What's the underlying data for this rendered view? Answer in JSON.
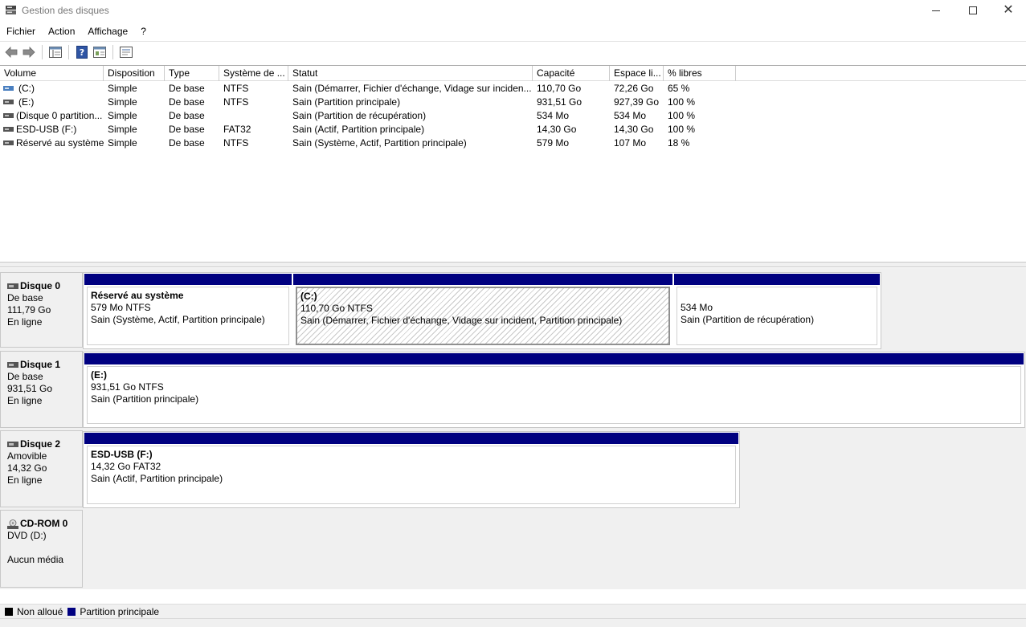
{
  "window": {
    "title": "Gestion des disques"
  },
  "menu": [
    "Fichier",
    "Action",
    "Affichage",
    "?"
  ],
  "volume_table": {
    "columns": [
      "Volume",
      "Disposition",
      "Type",
      "Système de ...",
      "Statut",
      "Capacité",
      "Espace li...",
      "% libres"
    ],
    "rows": [
      {
        "volume": "(C:)",
        "disposition": "Simple",
        "type": "De base",
        "fs": "NTFS",
        "status": "Sain (Démarrer, Fichier d'échange, Vidage sur inciden...",
        "capacity": "110,70 Go",
        "free": "72,26 Go",
        "pct": "65 %"
      },
      {
        "volume": "(E:)",
        "disposition": "Simple",
        "type": "De base",
        "fs": "NTFS",
        "status": "Sain (Partition principale)",
        "capacity": "931,51 Go",
        "free": "927,39 Go",
        "pct": "100 %"
      },
      {
        "volume": "(Disque 0 partition...",
        "disposition": "Simple",
        "type": "De base",
        "fs": "",
        "status": "Sain (Partition de récupération)",
        "capacity": "534 Mo",
        "free": "534 Mo",
        "pct": "100 %"
      },
      {
        "volume": "ESD-USB (F:)",
        "disposition": "Simple",
        "type": "De base",
        "fs": "FAT32",
        "status": "Sain (Actif, Partition principale)",
        "capacity": "14,30 Go",
        "free": "14,30 Go",
        "pct": "100 %"
      },
      {
        "volume": "Réservé au système",
        "disposition": "Simple",
        "type": "De base",
        "fs": "NTFS",
        "status": "Sain (Système, Actif, Partition principale)",
        "capacity": "579 Mo",
        "free": "107 Mo",
        "pct": "18 %"
      }
    ]
  },
  "disks": [
    {
      "name": "Disque 0",
      "kind": "De base",
      "size": "111,79 Go",
      "state": "En ligne",
      "partitions": [
        {
          "name": "Réservé au système",
          "size": "579 Mo NTFS",
          "status": "Sain (Système, Actif, Partition principale)"
        },
        {
          "name": "(C:)",
          "size": "110,70 Go NTFS",
          "status": "Sain (Démarrer, Fichier d'échange, Vidage sur incident, Partition principale)"
        },
        {
          "name": "",
          "size": "534 Mo",
          "status": "Sain (Partition de récupération)"
        }
      ]
    },
    {
      "name": "Disque 1",
      "kind": "De base",
      "size": "931,51 Go",
      "state": "En ligne",
      "partitions": [
        {
          "name": "(E:)",
          "size": "931,51 Go NTFS",
          "status": "Sain (Partition principale)"
        }
      ]
    },
    {
      "name": "Disque 2",
      "kind": "Amovible",
      "size": "14,32 Go",
      "state": "En ligne",
      "partitions": [
        {
          "name": "ESD-USB  (F:)",
          "size": "14,32 Go FAT32",
          "status": "Sain (Actif, Partition principale)"
        }
      ]
    },
    {
      "name": "CD-ROM 0",
      "kind": "DVD (D:)",
      "size": "",
      "state": "Aucun média",
      "partitions": []
    }
  ],
  "legend": [
    {
      "label": "Non alloué",
      "color": "#000000"
    },
    {
      "label": "Partition principale",
      "color": "#000080"
    }
  ],
  "colors": {
    "primary_partition": "#000080",
    "unallocated": "#000000"
  }
}
